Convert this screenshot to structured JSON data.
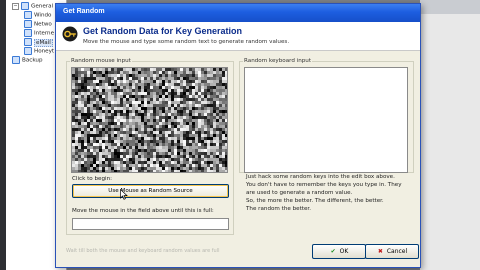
{
  "tree": {
    "items": [
      {
        "label": "General",
        "level": 0
      },
      {
        "label": "Windo",
        "level": 1
      },
      {
        "label": "Netwo",
        "level": 1
      },
      {
        "label": "Interne",
        "level": 1
      },
      {
        "label": "eMail",
        "level": 1
      },
      {
        "label": "Honeyt",
        "level": 1
      },
      {
        "label": "Backup",
        "level": 0
      }
    ]
  },
  "dialog": {
    "title": "Get Random",
    "header_title": "Get Random Data for Key Generation",
    "header_subtitle": "Move the mouse and type some random text to generate random values.",
    "mouse_group_label": "Random mouse input",
    "keyboard_group_label": "Random keyboard input",
    "click_label": "Click to begin:",
    "use_mouse_button": "Use Mouse as Random Source",
    "fill_label": "Move the mouse in the field above until this is full:",
    "progress_fraction": 0.0,
    "info_lines": [
      "Just hack some random keys into the edit box above.",
      "You don't have to remember the keys you type in. They",
      "are used to generate a random value.",
      "So, the more the better. The different, the better.",
      "The random the better."
    ],
    "footer_note": "Wait till both the mouse and keyboard random values are full",
    "ok_label": "OK",
    "cancel_label": "Cancel"
  },
  "colors": {
    "titlebar": "#1d5ee0",
    "header_title": "#0b2c8b",
    "dialog_bg": "#f1efe2"
  }
}
